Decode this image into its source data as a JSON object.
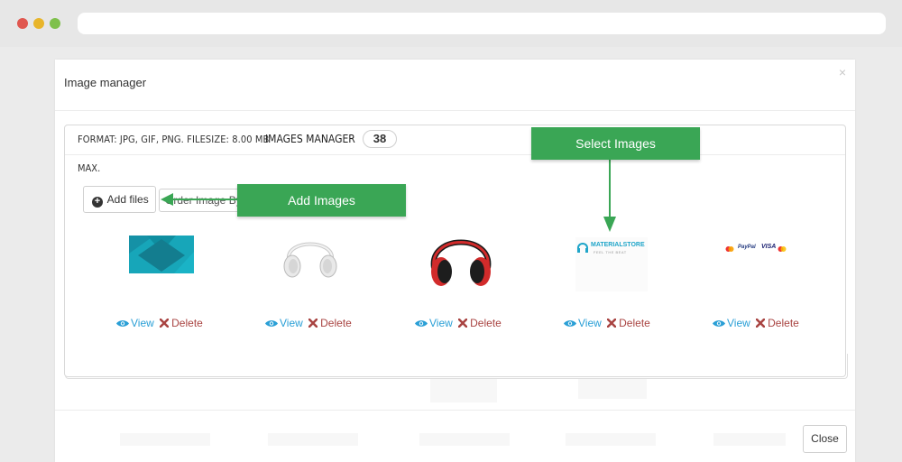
{
  "modal": {
    "title": "Image manager",
    "close_symbol": "×",
    "close_button": "Close"
  },
  "panel": {
    "format_text": "FORMAT: JPG, GIF, PNG. FILESIZE: 8.00 MB",
    "max_text": "MAX.",
    "manager_label": "IMAGES MANAGER",
    "image_count": "38",
    "add_files_label": "Add files",
    "order_button_label": "Order Image By"
  },
  "callouts": {
    "add_images": "Add Images",
    "select_images": "Select Images"
  },
  "images": [
    {
      "name": "teal-banner",
      "view": "View",
      "delete": "Delete"
    },
    {
      "name": "white-headphones",
      "view": "View",
      "delete": "Delete"
    },
    {
      "name": "red-headphones",
      "view": "View",
      "delete": "Delete"
    },
    {
      "name": "materialstore-logo",
      "view": "View",
      "delete": "Delete",
      "logo_text": "MATERIALSTORE",
      "logo_sub": "FEEL THE BEAT"
    },
    {
      "name": "payment-cards",
      "view": "View",
      "delete": "Delete",
      "paypal": "PayPal",
      "visa": "VISA"
    }
  ],
  "colors": {
    "callout_green": "#3aa655",
    "link_blue": "#2a9fd6",
    "delete_red": "#a94442"
  }
}
